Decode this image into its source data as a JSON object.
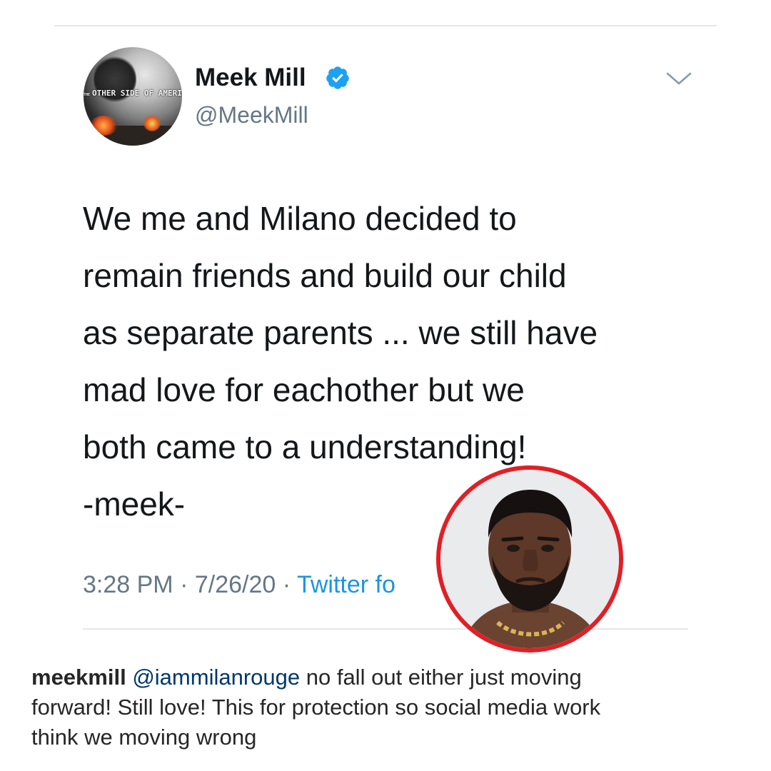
{
  "tweet": {
    "display_name": "Meek Mill",
    "handle": "@MeekMill",
    "avatar_text": "THE OTHER SIDE OF AMERICA",
    "text_lines": [
      "We me and Milano decided to",
      "remain friends and build our child",
      "as separate parents ... we still have",
      "mad love for eachother but we",
      "both came to a understanding!",
      "-meek-"
    ],
    "time": "3:28 PM",
    "date": "7/26/20",
    "separator": "·",
    "source": "Twitter fo",
    "verified_color": "#1da1f2",
    "icons": [
      "verified-badge-icon",
      "chevron-down-icon"
    ]
  },
  "inset_photo": {
    "border_color": "#e01f26"
  },
  "caption": {
    "username": "meekmill",
    "mention": "@iammilanrouge",
    "line1_rest": " no fall out either just moving",
    "line2": "forward!  Still love! This for protection so social media work",
    "line3": "think we moving wrong"
  }
}
